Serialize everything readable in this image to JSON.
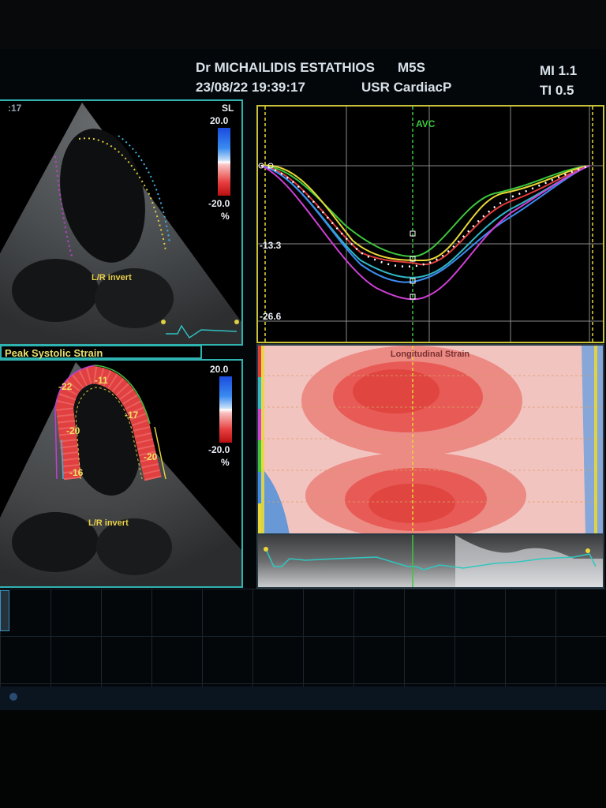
{
  "header": {
    "operator": "Dr MICHAILIDIS ESTATHIOS",
    "probe": "M5S",
    "datetime": "23/08/22 19:39:17",
    "preset": "USR CardiacP",
    "mi": "MI 1.1",
    "ti": "TI 0.5"
  },
  "top_image": {
    "frame_label": ":17",
    "scale_label": "SL",
    "scale_max": "20.0",
    "scale_min": "-20.0",
    "scale_unit": "%",
    "view_label": "L/R invert"
  },
  "bottom_image": {
    "title": "Peak Systolic Strain",
    "scale_max": "20.0",
    "scale_min": "-20.0",
    "scale_unit": "%",
    "view_label": "L/R invert",
    "segment_values": [
      "-22",
      "-11",
      "-17",
      "-20",
      "-20",
      "-16"
    ]
  },
  "strain_graph": {
    "event_label": "AVC",
    "y_ticks": [
      "-13.3",
      "-26.6"
    ],
    "colors": {
      "yellow": "#e8d838",
      "green": "#3cc83c",
      "red": "#e03c3c",
      "blue": "#3c8cf0",
      "cyan": "#30b8c8",
      "magenta": "#d040d8",
      "average": "#ffffff"
    }
  },
  "strain_map": {
    "title": "Longitudinal Strain"
  },
  "colors": {
    "panel_border": "#2fb3b0",
    "graph_border": "#c8c23a",
    "label_text": "#e8e070"
  }
}
